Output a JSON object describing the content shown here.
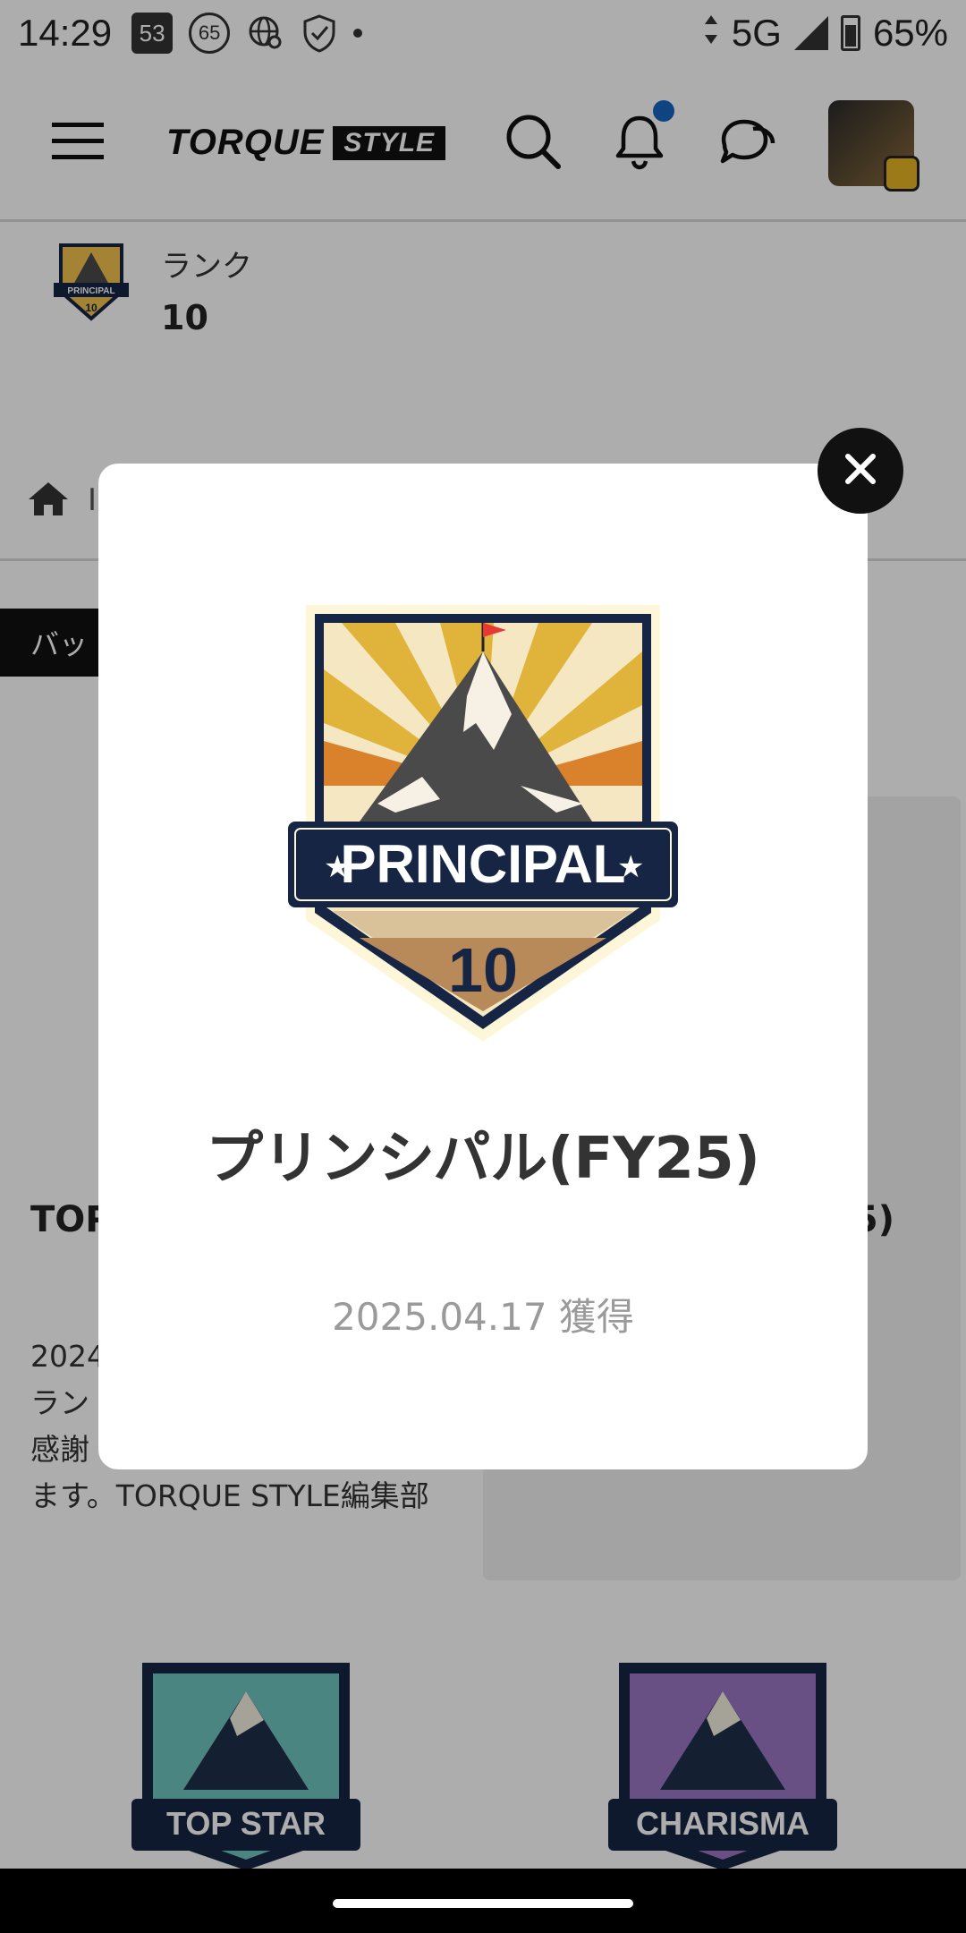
{
  "status_bar": {
    "time": "14:29",
    "notif_badge_1": "53",
    "notif_badge_2": "65",
    "network": "5G",
    "battery": "65%"
  },
  "header": {
    "logo_text": "TORQUE",
    "logo_box": "STYLE",
    "icons": [
      "menu-icon",
      "search-icon",
      "bell-icon",
      "chat-icon",
      "avatar"
    ]
  },
  "rank": {
    "label": "ランク",
    "value": "10"
  },
  "breadcrumb": {
    "partial": "I"
  },
  "tab": {
    "label": "バッ"
  },
  "cards": {
    "left_title_partial": "TOP",
    "right_title_partial": "5)",
    "desc_lines": [
      "2024",
      "ラン",
      "感謝",
      "ます。TORQUE STYLE編集部"
    ]
  },
  "bottom_badges": [
    {
      "label": "TOP STAR"
    },
    {
      "label": "CHARISMA"
    }
  ],
  "modal": {
    "badge_label": "PRINCIPAL",
    "badge_number": "10",
    "title": "プリンシパル(FY25)",
    "date": "2025.04.17 獲得"
  },
  "colors": {
    "overlay": "#000000",
    "accent_blue": "#1565c0",
    "badge_navy": "#172544",
    "badge_gold": "#e6b422",
    "topstar_teal": "#3e9e9a",
    "charisma_purple": "#7b56a8"
  }
}
